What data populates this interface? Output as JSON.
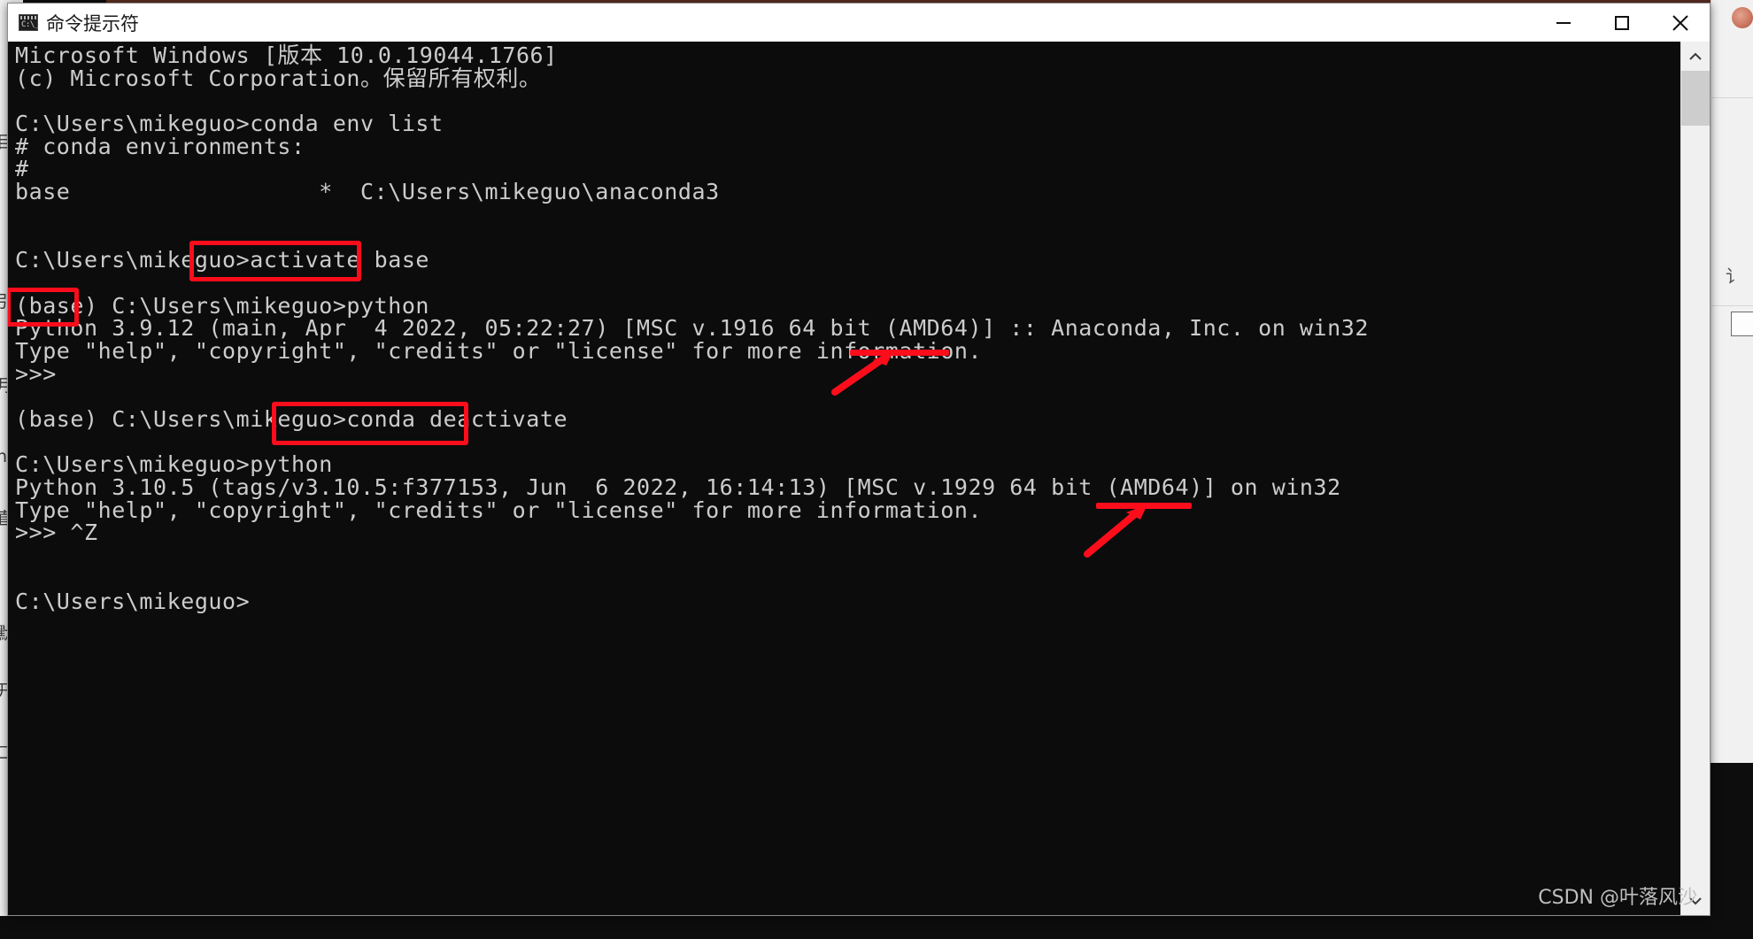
{
  "window": {
    "title": "命令提示符",
    "icon_name": "command-prompt-icon",
    "icon_glyph": "C:\\_",
    "controls": {
      "minimize_label": "最小化",
      "maximize_label": "最大化",
      "close_label": "关闭"
    }
  },
  "console": {
    "background_color": "#0c0c0c",
    "text_color": "#cccccc",
    "lines": [
      "Microsoft Windows [版本 10.0.19044.1766]",
      "(c) Microsoft Corporation。保留所有权利。",
      "",
      "C:\\Users\\mikeguo>conda env list",
      "# conda environments:",
      "#",
      "base                  *  C:\\Users\\mikeguo\\anaconda3",
      "",
      "",
      "C:\\Users\\mikeguo>activate base",
      "",
      "(base) C:\\Users\\mikeguo>python",
      "Python 3.9.12 (main, Apr  4 2022, 05:22:27) [MSC v.1916 64 bit (AMD64)] :: Anaconda, Inc. on win32",
      "Type \"help\", \"copyright\", \"credits\" or \"license\" for more information.",
      ">>>",
      "",
      "(base) C:\\Users\\mikeguo>conda deactivate",
      "",
      "C:\\Users\\mikeguo>python",
      "Python 3.10.5 (tags/v3.10.5:f377153, Jun  6 2022, 16:14:13) [MSC v.1929 64 bit (AMD64)] on win32",
      "Type \"help\", \"copyright\", \"credits\" or \"license\" for more information.",
      ">>> ^Z",
      "",
      "",
      "C:\\Users\\mikeguo>"
    ]
  },
  "annotations": {
    "color": "#fc0d1b",
    "boxes": [
      {
        "name": "activate-base-highlight",
        "text": "activate base"
      },
      {
        "name": "base-env-prefix-highlight",
        "text": "(base)"
      },
      {
        "name": "conda-deactivate-highlight",
        "text": "conda deactivate"
      }
    ],
    "callouts": [
      {
        "name": "anaconda-underline-callout",
        "target": "Anaconda,"
      },
      {
        "name": "win32-underline-callout",
        "target": "on win32"
      }
    ]
  },
  "scrollbar": {
    "up_arrow": "scroll-up-arrow",
    "down_arrow": "scroll-down-arrow"
  },
  "watermark": {
    "text": "CSDN @叶落风沙"
  },
  "background_windows": {
    "left_strip_glyphs": "目 引 月 直 默 开 口",
    "right_glyph": "讠"
  }
}
